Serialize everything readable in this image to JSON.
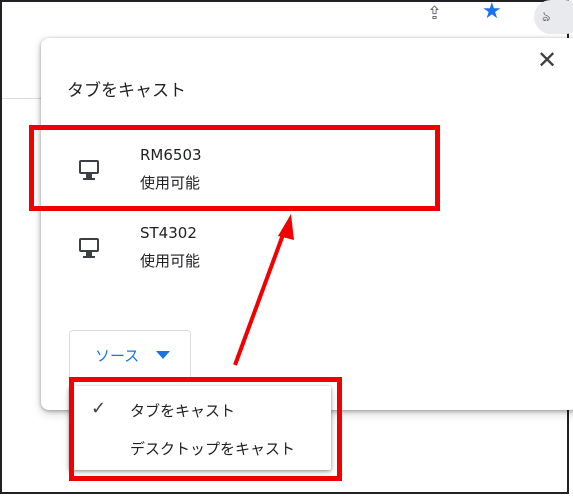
{
  "dialog": {
    "title": "タブをキャスト",
    "close_glyph": "✕"
  },
  "sinks": [
    {
      "name": "RM6503",
      "status": "使用可能"
    },
    {
      "name": "ST4302",
      "status": "使用可能"
    }
  ],
  "sources_button": {
    "label": "ソース"
  },
  "source_menu": {
    "items": [
      {
        "label": "タブをキャスト",
        "selected": true,
        "check_glyph": "✓"
      },
      {
        "label": "デスクトップをキャスト",
        "selected": false
      }
    ]
  },
  "toolbar": {
    "share_glyph": "⇪",
    "star_glyph": "★",
    "cast_glyph": "ঌ",
    "icons": [
      "share-icon",
      "bookmark-star-icon",
      "cast-icon"
    ]
  },
  "colors": {
    "accent": "#1a73e8",
    "annotation": "#f00000",
    "text": "#202124"
  }
}
